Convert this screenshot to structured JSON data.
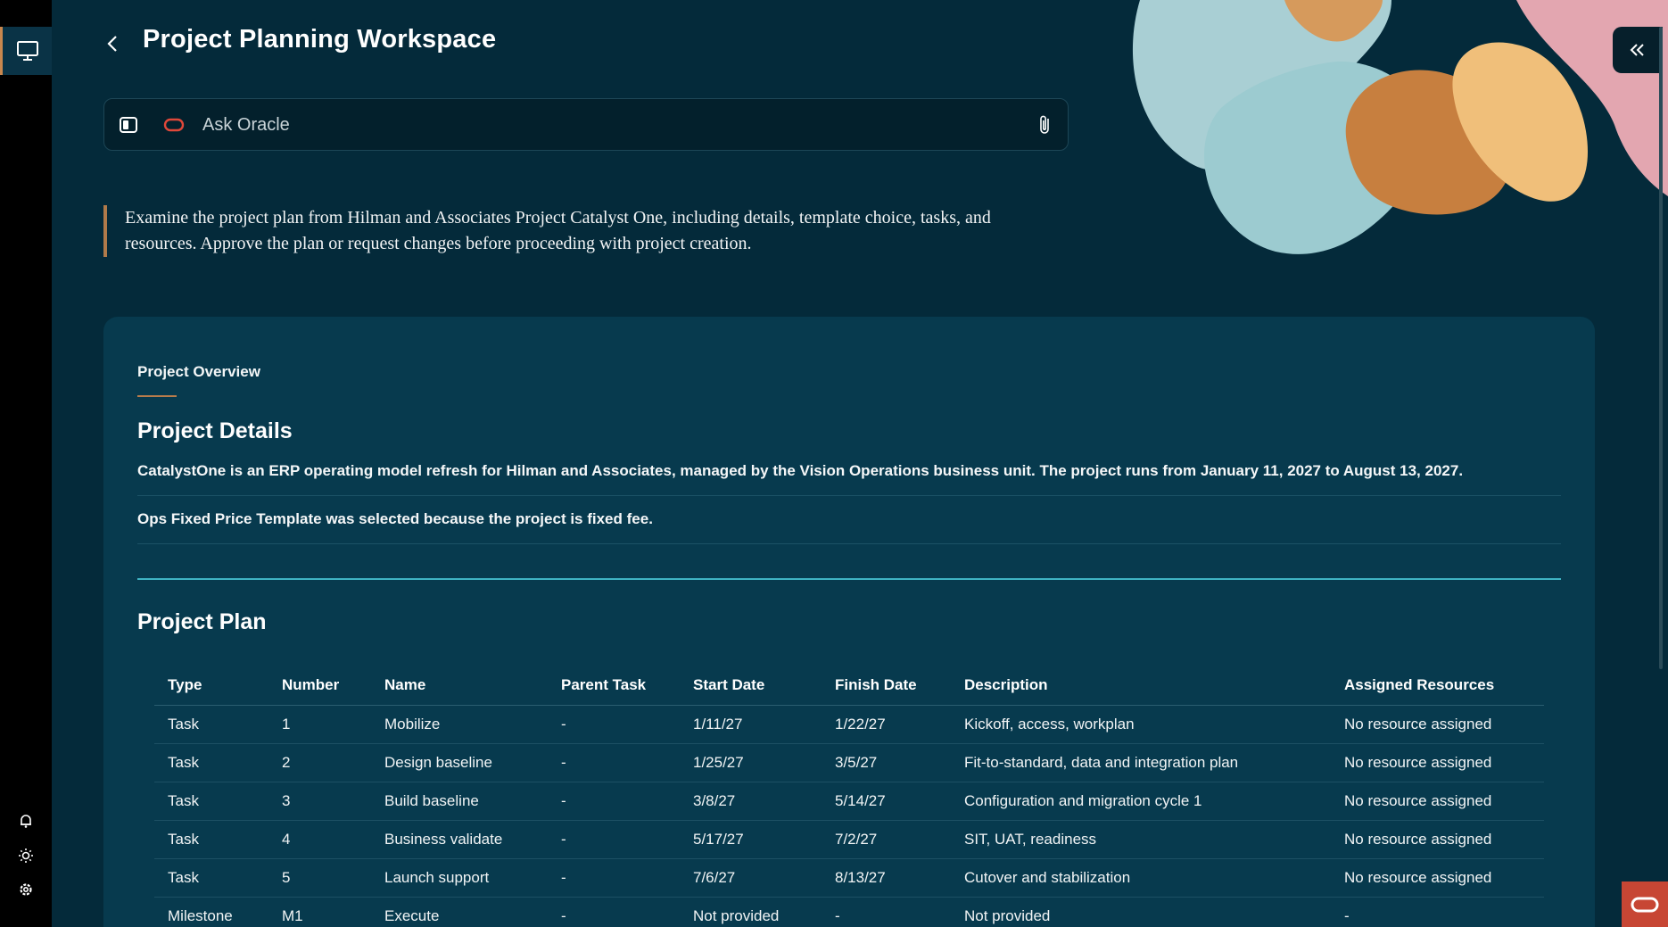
{
  "header": {
    "title": "Project Planning Workspace",
    "back_icon": "chevron-left-icon"
  },
  "ask_bar": {
    "placeholder": "Ask Oracle",
    "value": ""
  },
  "intro": {
    "text": "Examine the project plan from Hilman and Associates Project Catalyst One, including details, template choice, tasks, and resources. Approve the plan or request changes before proceeding with project creation."
  },
  "card": {
    "tab_label": "Project Overview",
    "details": {
      "title": "Project Details",
      "line1": "CatalystOne is an ERP operating model refresh for Hilman and Associates, managed by the Vision Operations business unit. The project runs from January 11, 2027 to August 13, 2027.",
      "line2": "Ops Fixed Price Template was selected because the project is fixed fee."
    },
    "plan": {
      "title": "Project Plan",
      "columns": [
        "Type",
        "Number",
        "Name",
        "Parent Task",
        "Start Date",
        "Finish Date",
        "Description",
        "Assigned Resources"
      ],
      "rows": [
        [
          "Task",
          "1",
          "Mobilize",
          "-",
          "1/11/27",
          "1/22/27",
          "Kickoff, access, workplan",
          "No resource assigned"
        ],
        [
          "Task",
          "2",
          "Design baseline",
          "-",
          "1/25/27",
          "3/5/27",
          "Fit-to-standard, data and integration plan",
          "No resource assigned"
        ],
        [
          "Task",
          "3",
          "Build baseline",
          "-",
          "3/8/27",
          "5/14/27",
          "Configuration and migration cycle 1",
          "No resource assigned"
        ],
        [
          "Task",
          "4",
          "Business validate",
          "-",
          "5/17/27",
          "7/2/27",
          "SIT, UAT, readiness",
          "No resource assigned"
        ],
        [
          "Task",
          "5",
          "Launch support",
          "-",
          "7/6/27",
          "8/13/27",
          "Cutover and stabilization",
          "No resource assigned"
        ],
        [
          "Milestone",
          "M1",
          "Execute",
          "-",
          "Not provided",
          "-",
          "Not provided",
          "-"
        ]
      ]
    }
  },
  "colors": {
    "background": "#042a3a",
    "card": "#073a4e",
    "accent_copper": "#b97c4b",
    "divider_teal": "#3fb3c3",
    "oracle_red": "#c74634"
  },
  "icons": {
    "rail_top": "monitor-icon",
    "rail_bottom": [
      "bell-icon",
      "sun-icon",
      "gear-icon"
    ],
    "collapse": "double-chevron-left-icon",
    "attach": "paperclip-icon",
    "fab": "oracle-logo-icon"
  }
}
